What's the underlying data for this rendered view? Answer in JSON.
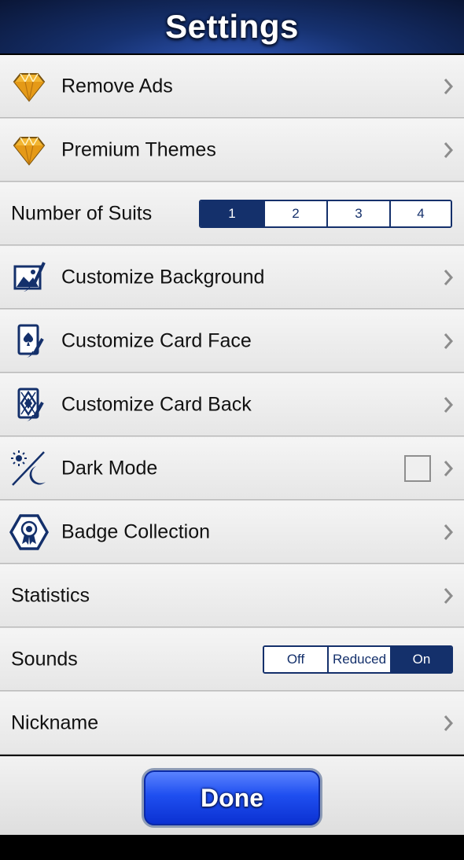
{
  "header": {
    "title": "Settings"
  },
  "rows": [
    {
      "label": "Remove Ads",
      "icon": "diamond-icon"
    },
    {
      "label": "Premium Themes",
      "icon": "diamond-icon"
    },
    {
      "label": "Number of Suits",
      "options": [
        "1",
        "2",
        "3",
        "4"
      ],
      "selected": "1"
    },
    {
      "label": "Customize Background",
      "icon": "background-brush-icon"
    },
    {
      "label": "Customize Card Face",
      "icon": "card-face-brush-icon"
    },
    {
      "label": "Customize Card Back",
      "icon": "card-back-brush-icon"
    },
    {
      "label": "Dark Mode",
      "icon": "sun-moon-icon",
      "checked": false
    },
    {
      "label": "Badge Collection",
      "icon": "badge-icon"
    },
    {
      "label": "Statistics"
    },
    {
      "label": "Sounds",
      "options": [
        "Off",
        "Reduced",
        "On"
      ],
      "selected": "On"
    },
    {
      "label": "Nickname"
    }
  ],
  "footer": {
    "done_label": "Done"
  },
  "colors": {
    "accent": "#14306b",
    "done_button": "#1f4ff0",
    "diamond": "#f2b531"
  }
}
